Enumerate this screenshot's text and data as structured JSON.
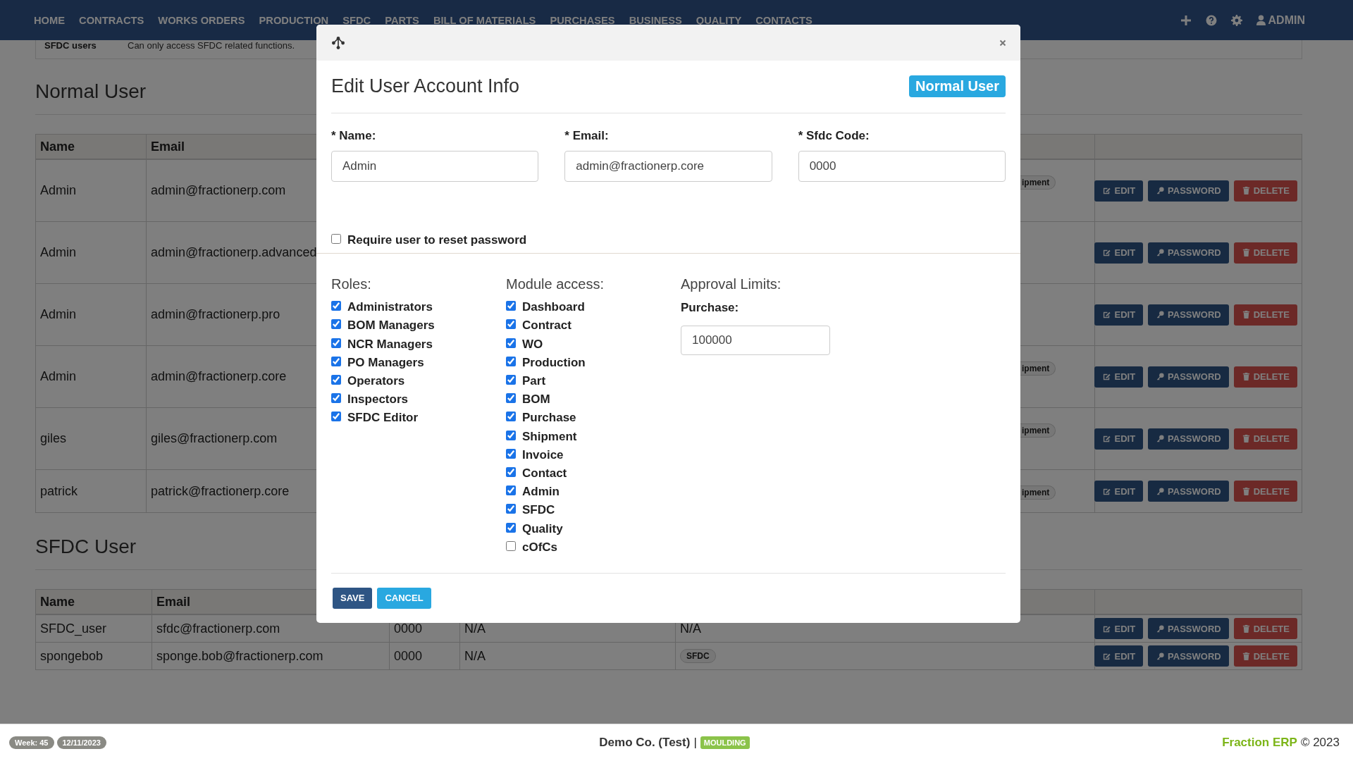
{
  "nav": {
    "items": [
      "HOME",
      "CONTRACTS",
      "WORKS ORDERS",
      "PRODUCTION",
      "SFDC",
      "PARTS",
      "BILL OF MATERIALS",
      "PURCHASES",
      "BUSINESS",
      "QUALITY",
      "CONTACTS"
    ],
    "user": "ADMIN"
  },
  "top_row": {
    "label": "SFDC users",
    "description": "Can only access SFDC related functions."
  },
  "normal_section": {
    "title": "Normal User",
    "columns": [
      "Name",
      "Email"
    ],
    "rows": [
      {
        "cells": [
          "Admin",
          "admin@fractionerp.com"
        ],
        "tag": "ipment",
        "actions": [
          {
            "label": "EDIT",
            "kind": "edit"
          },
          {
            "label": "PASSWORD",
            "kind": "password"
          },
          {
            "label": "DELETE",
            "kind": "delete"
          }
        ]
      },
      {
        "cells": [
          "Admin",
          "admin@fractionerp.advanced"
        ],
        "actions": [
          {
            "label": "EDIT",
            "kind": "edit"
          },
          {
            "label": "PASSWORD",
            "kind": "password"
          },
          {
            "label": "DELETE",
            "kind": "delete"
          }
        ]
      },
      {
        "cells": [
          "Admin",
          "admin@fractionerp.pro"
        ],
        "actions": [
          {
            "label": "EDIT",
            "kind": "edit"
          },
          {
            "label": "PASSWORD",
            "kind": "password"
          },
          {
            "label": "DELETE",
            "kind": "delete"
          }
        ]
      },
      {
        "cells": [
          "Admin",
          "admin@fractionerp.core"
        ],
        "tag": "ipment",
        "actions": [
          {
            "label": "EDIT",
            "kind": "edit"
          },
          {
            "label": "PASSWORD",
            "kind": "password"
          },
          {
            "label": "DELETE",
            "kind": "delete"
          }
        ]
      },
      {
        "cells": [
          "giles",
          "giles@fractionerp.com"
        ],
        "tag": "ipment",
        "actions": [
          {
            "label": "EDIT",
            "kind": "edit"
          },
          {
            "label": "PASSWORD",
            "kind": "password"
          },
          {
            "label": "DELETE",
            "kind": "delete"
          }
        ]
      },
      {
        "cells": [
          "patrick",
          "patrick@fractionerp.core"
        ],
        "tag": "ipment",
        "actions": [
          {
            "label": "EDIT",
            "kind": "edit"
          },
          {
            "label": "PASSWORD",
            "kind": "password"
          },
          {
            "label": "DELETE",
            "kind": "delete"
          }
        ]
      }
    ]
  },
  "sfdc_section": {
    "title": "SFDC User",
    "columns": [
      "Name",
      "Email"
    ],
    "rows": [
      {
        "cells": [
          "SFDC_user",
          "sfdc@fractionerp.com",
          "0000",
          "N/A",
          "N/A"
        ],
        "actions": [
          {
            "label": "EDIT",
            "kind": "edit"
          },
          {
            "label": "PASSWORD",
            "kind": "password"
          },
          {
            "label": "DELETE",
            "kind": "delete"
          }
        ]
      },
      {
        "cells": [
          "spongebob",
          "sponge.bob@fractionerp.com",
          "0000",
          "N/A"
        ],
        "tag": "SFDC",
        "actions": [
          {
            "label": "EDIT",
            "kind": "edit"
          },
          {
            "label": "PASSWORD",
            "kind": "password"
          },
          {
            "label": "DELETE",
            "kind": "delete"
          }
        ]
      }
    ]
  },
  "modal": {
    "title": "Edit User Account Info",
    "badge": "Normal User",
    "fields": [
      {
        "label": "* Name:",
        "value": "Admin"
      },
      {
        "label": "* Email:",
        "value": "admin@fractionerp.core"
      },
      {
        "label": "* Sfdc Code:",
        "value": "0000"
      }
    ],
    "reset_password": {
      "label": "Require user to reset password",
      "checked": false
    },
    "roles": {
      "heading": "Roles:",
      "items": [
        {
          "label": "Administrators",
          "checked": true
        },
        {
          "label": "BOM Managers",
          "checked": true
        },
        {
          "label": "NCR Managers",
          "checked": true
        },
        {
          "label": "PO Managers",
          "checked": true
        },
        {
          "label": "Operators",
          "checked": true
        },
        {
          "label": "Inspectors",
          "checked": true
        },
        {
          "label": "SFDC Editor",
          "checked": true
        }
      ]
    },
    "modules": {
      "heading": "Module access:",
      "items": [
        {
          "label": "Dashboard",
          "checked": true
        },
        {
          "label": "Contract",
          "checked": true
        },
        {
          "label": "WO",
          "checked": true
        },
        {
          "label": "Production",
          "checked": true
        },
        {
          "label": "Part",
          "checked": true
        },
        {
          "label": "BOM",
          "checked": true
        },
        {
          "label": "Purchase",
          "checked": true
        },
        {
          "label": "Shipment",
          "checked": true
        },
        {
          "label": "Invoice",
          "checked": true
        },
        {
          "label": "Contact",
          "checked": true
        },
        {
          "label": "Admin",
          "checked": true
        },
        {
          "label": "SFDC",
          "checked": true
        },
        {
          "label": "Quality",
          "checked": true
        },
        {
          "label": "cOfCs",
          "checked": false
        }
      ]
    },
    "approval": {
      "heading": "Approval Limits:",
      "field_label": "Purchase:",
      "value": "100000"
    },
    "buttons": [
      {
        "label": "SAVE",
        "kind": "primary"
      },
      {
        "label": "CANCEL",
        "kind": "secondary"
      }
    ]
  },
  "footer": {
    "week": "Week: 45",
    "date": "12/11/2023",
    "company": "Demo Co. (Test)",
    "separator": "|",
    "tag": "MOULDING",
    "brand": "Fraction ERP",
    "copyright": "© 2023"
  }
}
